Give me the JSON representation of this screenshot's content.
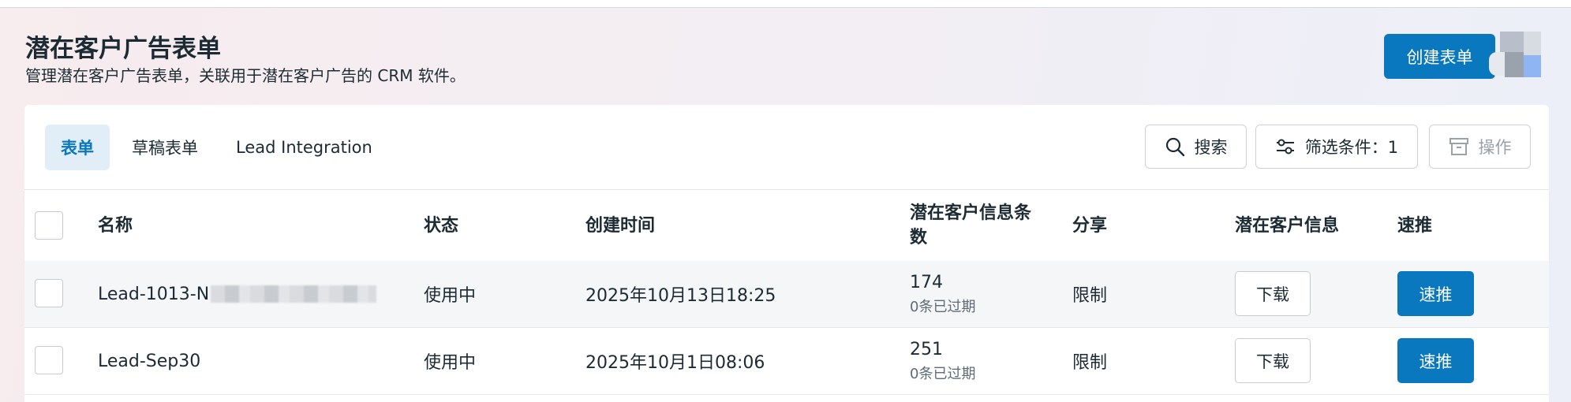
{
  "header": {
    "title": "潜在客户广告表单",
    "subtitle": "管理潜在客户广告表单，关联用于潜在客户广告的 CRM 软件。",
    "create_button": "创建表单"
  },
  "tabs": [
    {
      "label": "表单",
      "active": true
    },
    {
      "label": "草稿表单",
      "active": false
    },
    {
      "label": "Lead Integration",
      "active": false
    }
  ],
  "toolbar": {
    "search": "搜索",
    "filter": "筛选条件：1",
    "actions": "操作"
  },
  "table": {
    "columns": [
      "名称",
      "状态",
      "创建时间",
      "潜在客户信息条数",
      "分享",
      "潜在客户信息",
      "速推"
    ],
    "rows": [
      {
        "name": "Lead-1013-N",
        "name_redacted": true,
        "status": "使用中",
        "created": "2025年10月13日18:25",
        "count": "174",
        "expired": "0条已过期",
        "share": "限制",
        "download": "下载",
        "boost": "速推"
      },
      {
        "name": "Lead-Sep30",
        "name_redacted": false,
        "status": "使用中",
        "created": "2025年10月1日08:06",
        "count": "251",
        "expired": "0条已过期",
        "share": "限制",
        "download": "下载",
        "boost": "速推"
      }
    ]
  },
  "colors": {
    "primary": "#0a78be",
    "tab_active_bg": "#e1edf7"
  },
  "icons": [
    "search-icon",
    "filter-icon",
    "archive-icon"
  ]
}
